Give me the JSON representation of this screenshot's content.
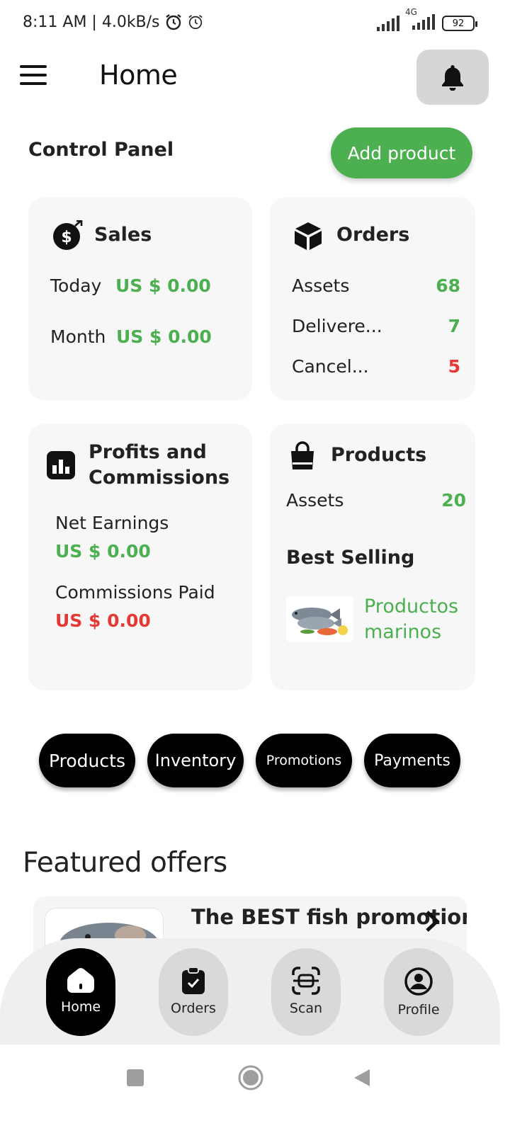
{
  "status_bar": {
    "time_speed": "8:11 AM | 4.0kB/s",
    "network": "4G",
    "battery": "92"
  },
  "header": {
    "title": "Home"
  },
  "control_panel": {
    "title": "Control Panel",
    "add_button": "Add product"
  },
  "sales": {
    "title": "Sales",
    "today_label": "Today",
    "today_value": "US $ 0.00",
    "month_label": "Month",
    "month_value": "US $ 0.00"
  },
  "orders": {
    "title": "Orders",
    "rows": [
      {
        "label": "Assets",
        "value": "68",
        "color": "#4caf50"
      },
      {
        "label": "Delivere...",
        "value": "7",
        "color": "#4caf50"
      },
      {
        "label": "Cancel...",
        "value": "5",
        "color": "#e53935"
      }
    ]
  },
  "profits": {
    "title_line1": "Profits and",
    "title_line2": "Commissions",
    "net_label": "Net Earnings",
    "net_value": "US $ 0.00",
    "comm_label": "Commissions Paid",
    "comm_value": "US $ 0.00"
  },
  "products": {
    "title": "Products",
    "assets_label": "Assets",
    "assets_value": "20",
    "best_title": "Best Selling",
    "best_name_line1": "Productos",
    "best_name_line2": "marinos"
  },
  "quick_actions": [
    "Products",
    "Inventory",
    "Promotions",
    "Payments"
  ],
  "featured": {
    "title": "Featured offers",
    "offer_title": "The BEST fish promotion"
  },
  "bottom_nav": [
    "Home",
    "Orders",
    "Scan",
    "Profile"
  ],
  "colors": {
    "accent": "#4caf50",
    "danger": "#e53935",
    "dark": "#000000"
  }
}
